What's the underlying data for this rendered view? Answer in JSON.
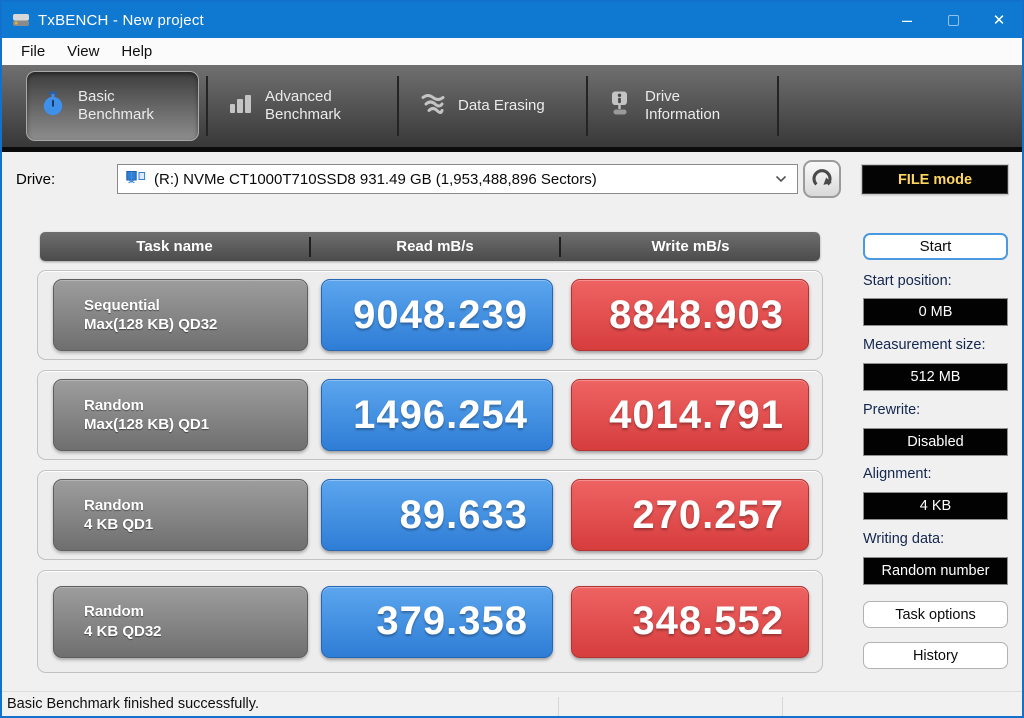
{
  "window": {
    "title": "TxBENCH - New project",
    "controls": {
      "minimize": "–",
      "close": "✕"
    }
  },
  "menu": {
    "items": [
      "File",
      "View",
      "Help"
    ]
  },
  "tabs": [
    {
      "label_line1": "Basic",
      "label_line2": "Benchmark",
      "icon": "stopwatch-icon",
      "active": true
    },
    {
      "label_line1": "Advanced",
      "label_line2": "Benchmark",
      "icon": "bar-chart-icon",
      "active": false
    },
    {
      "label_line1": "Data Erasing",
      "label_line2": "",
      "icon": "data-erasing-icon",
      "active": false
    },
    {
      "label_line1": "Drive",
      "label_line2": "Information",
      "icon": "drive-info-icon",
      "active": false
    }
  ],
  "drive": {
    "label": "Drive:",
    "selected": "(R:) NVMe CT1000T710SSD8  931.49 GB (1,953,488,896 Sectors)",
    "file_mode": "FILE mode"
  },
  "table": {
    "headers": [
      "Task name",
      "Read mB/s",
      "Write mB/s"
    ],
    "rows": [
      {
        "task_line1": "Sequential",
        "task_line2": "Max(128 KB) QD32",
        "read": "9048.239",
        "write": "8848.903"
      },
      {
        "task_line1": "Random",
        "task_line2": "Max(128 KB) QD1",
        "read": "1496.254",
        "write": "4014.791"
      },
      {
        "task_line1": "Random",
        "task_line2": "4 KB QD1",
        "read": "89.633",
        "write": "270.257"
      },
      {
        "task_line1": "Random",
        "task_line2": "4 KB QD32",
        "read": "379.358",
        "write": "348.552"
      }
    ]
  },
  "sidebar": {
    "start": "Start",
    "fields": [
      {
        "label": "Start position:",
        "value": "0 MB"
      },
      {
        "label": "Measurement size:",
        "value": "512 MB"
      },
      {
        "label": "Prewrite:",
        "value": "Disabled"
      },
      {
        "label": "Alignment:",
        "value": "4 KB"
      },
      {
        "label": "Writing data:",
        "value": "Random number"
      }
    ],
    "task_options": "Task options",
    "history": "History"
  },
  "status": {
    "message": "Basic Benchmark finished successfully."
  },
  "colors": {
    "titlebar_blue": "#0f79d2",
    "read_blue": "#3a86e0",
    "write_red": "#dd4545",
    "file_mode_text": "#ffd75e"
  }
}
